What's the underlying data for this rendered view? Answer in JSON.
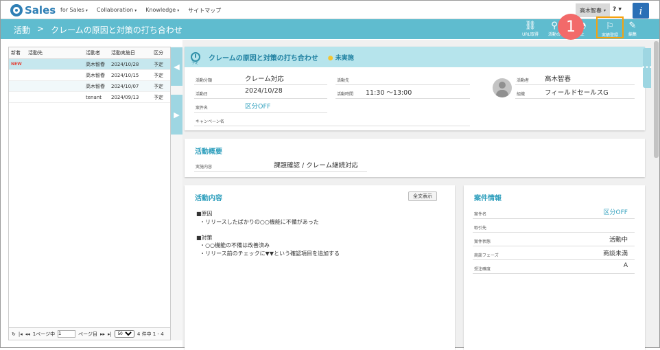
{
  "app": {
    "logo_text": "Sales"
  },
  "nav": {
    "items": [
      {
        "label": "for Sales",
        "caret": "▾"
      },
      {
        "label": "Collaboration",
        "caret": "▾"
      },
      {
        "label": "Knowledge",
        "caret": "▾"
      },
      {
        "label": "サイトマップ",
        "caret": ""
      }
    ],
    "user": "高木智春",
    "user_caret": "▾",
    "help": "? ▾",
    "info": "i"
  },
  "header": {
    "crumb_root": "活動",
    "crumb_sep": ">",
    "crumb_title": "クレームの原因と対策の打ち合わせ",
    "toolbar": {
      "url": "URL取得",
      "activity": "活動の",
      "stop": "止",
      "done": "実績登録",
      "edit": "編集"
    },
    "step_badge": "1"
  },
  "list": {
    "headers": [
      "新着",
      "活動先",
      "活動者",
      "活動実施日",
      "区分"
    ],
    "rows": [
      {
        "new": "NEW",
        "dest": "",
        "person": "高木智春",
        "date": "2024/10/28",
        "kind": "予定"
      },
      {
        "new": "",
        "dest": "",
        "person": "高木智春",
        "date": "2024/10/15",
        "kind": "予定"
      },
      {
        "new": "",
        "dest": "",
        "person": "高木智春",
        "date": "2024/10/07",
        "kind": "予定"
      },
      {
        "new": "",
        "dest": "",
        "person": "tenant",
        "date": "2024/09/13",
        "kind": "予定"
      }
    ],
    "pager": {
      "refresh": "↻",
      "first": "|◂",
      "prev": "◂◂",
      "page_prefix": "1ページ中",
      "page_value": "1",
      "page_suffix": "ページ目",
      "next": "▸▸",
      "last": "▸|",
      "size": "50",
      "count": "4 件中 1 - 4"
    }
  },
  "detail": {
    "title": "クレームの原因と対策の打ち合わせ",
    "status": "未実施",
    "schedule_label": "予定",
    "fields": {
      "kind_label": "活動分類",
      "kind_value": "クレーム対応",
      "dest_label": "活動先",
      "dest_value": "",
      "date_label": "活動日",
      "date_value": "2024/10/28",
      "time_label": "活動時間",
      "time_value": "11:30 ～13:00",
      "deal_label": "案件名",
      "deal_value": "区分OFF",
      "campaign_label": "キャンペーン名",
      "campaign_value": "",
      "person_label": "活動者",
      "person_value": "高木智春",
      "org_label": "組織",
      "org_value": "フィールドセールスG"
    }
  },
  "summary": {
    "title": "活動概要",
    "content_label": "実施内容",
    "content_value": "課題確認 / クレーム継続対応"
  },
  "contents": {
    "title": "活動内容",
    "full_button": "全文表示",
    "body": "■原因\n  ・リリースしたばかりの○○機能に不備があった\n\n■対策\n  ・○○機能の不備は改善済み\n  ・リリース前のチェックに▼▼という確認項目を追加する"
  },
  "deal": {
    "title": "案件情報",
    "rows": [
      {
        "label": "案件名",
        "value": "区分OFF"
      },
      {
        "label": "取引先",
        "value": ""
      },
      {
        "label": "案件状態",
        "value": "活動中"
      },
      {
        "label": "商談フェーズ",
        "value": "商談未満"
      },
      {
        "label": "受注確度",
        "value": "A"
      }
    ]
  },
  "colors": {
    "accent": "#5fbccf",
    "link": "#2f9fbd",
    "highlight": "#f5a20f",
    "badge": "#f26a6a"
  }
}
